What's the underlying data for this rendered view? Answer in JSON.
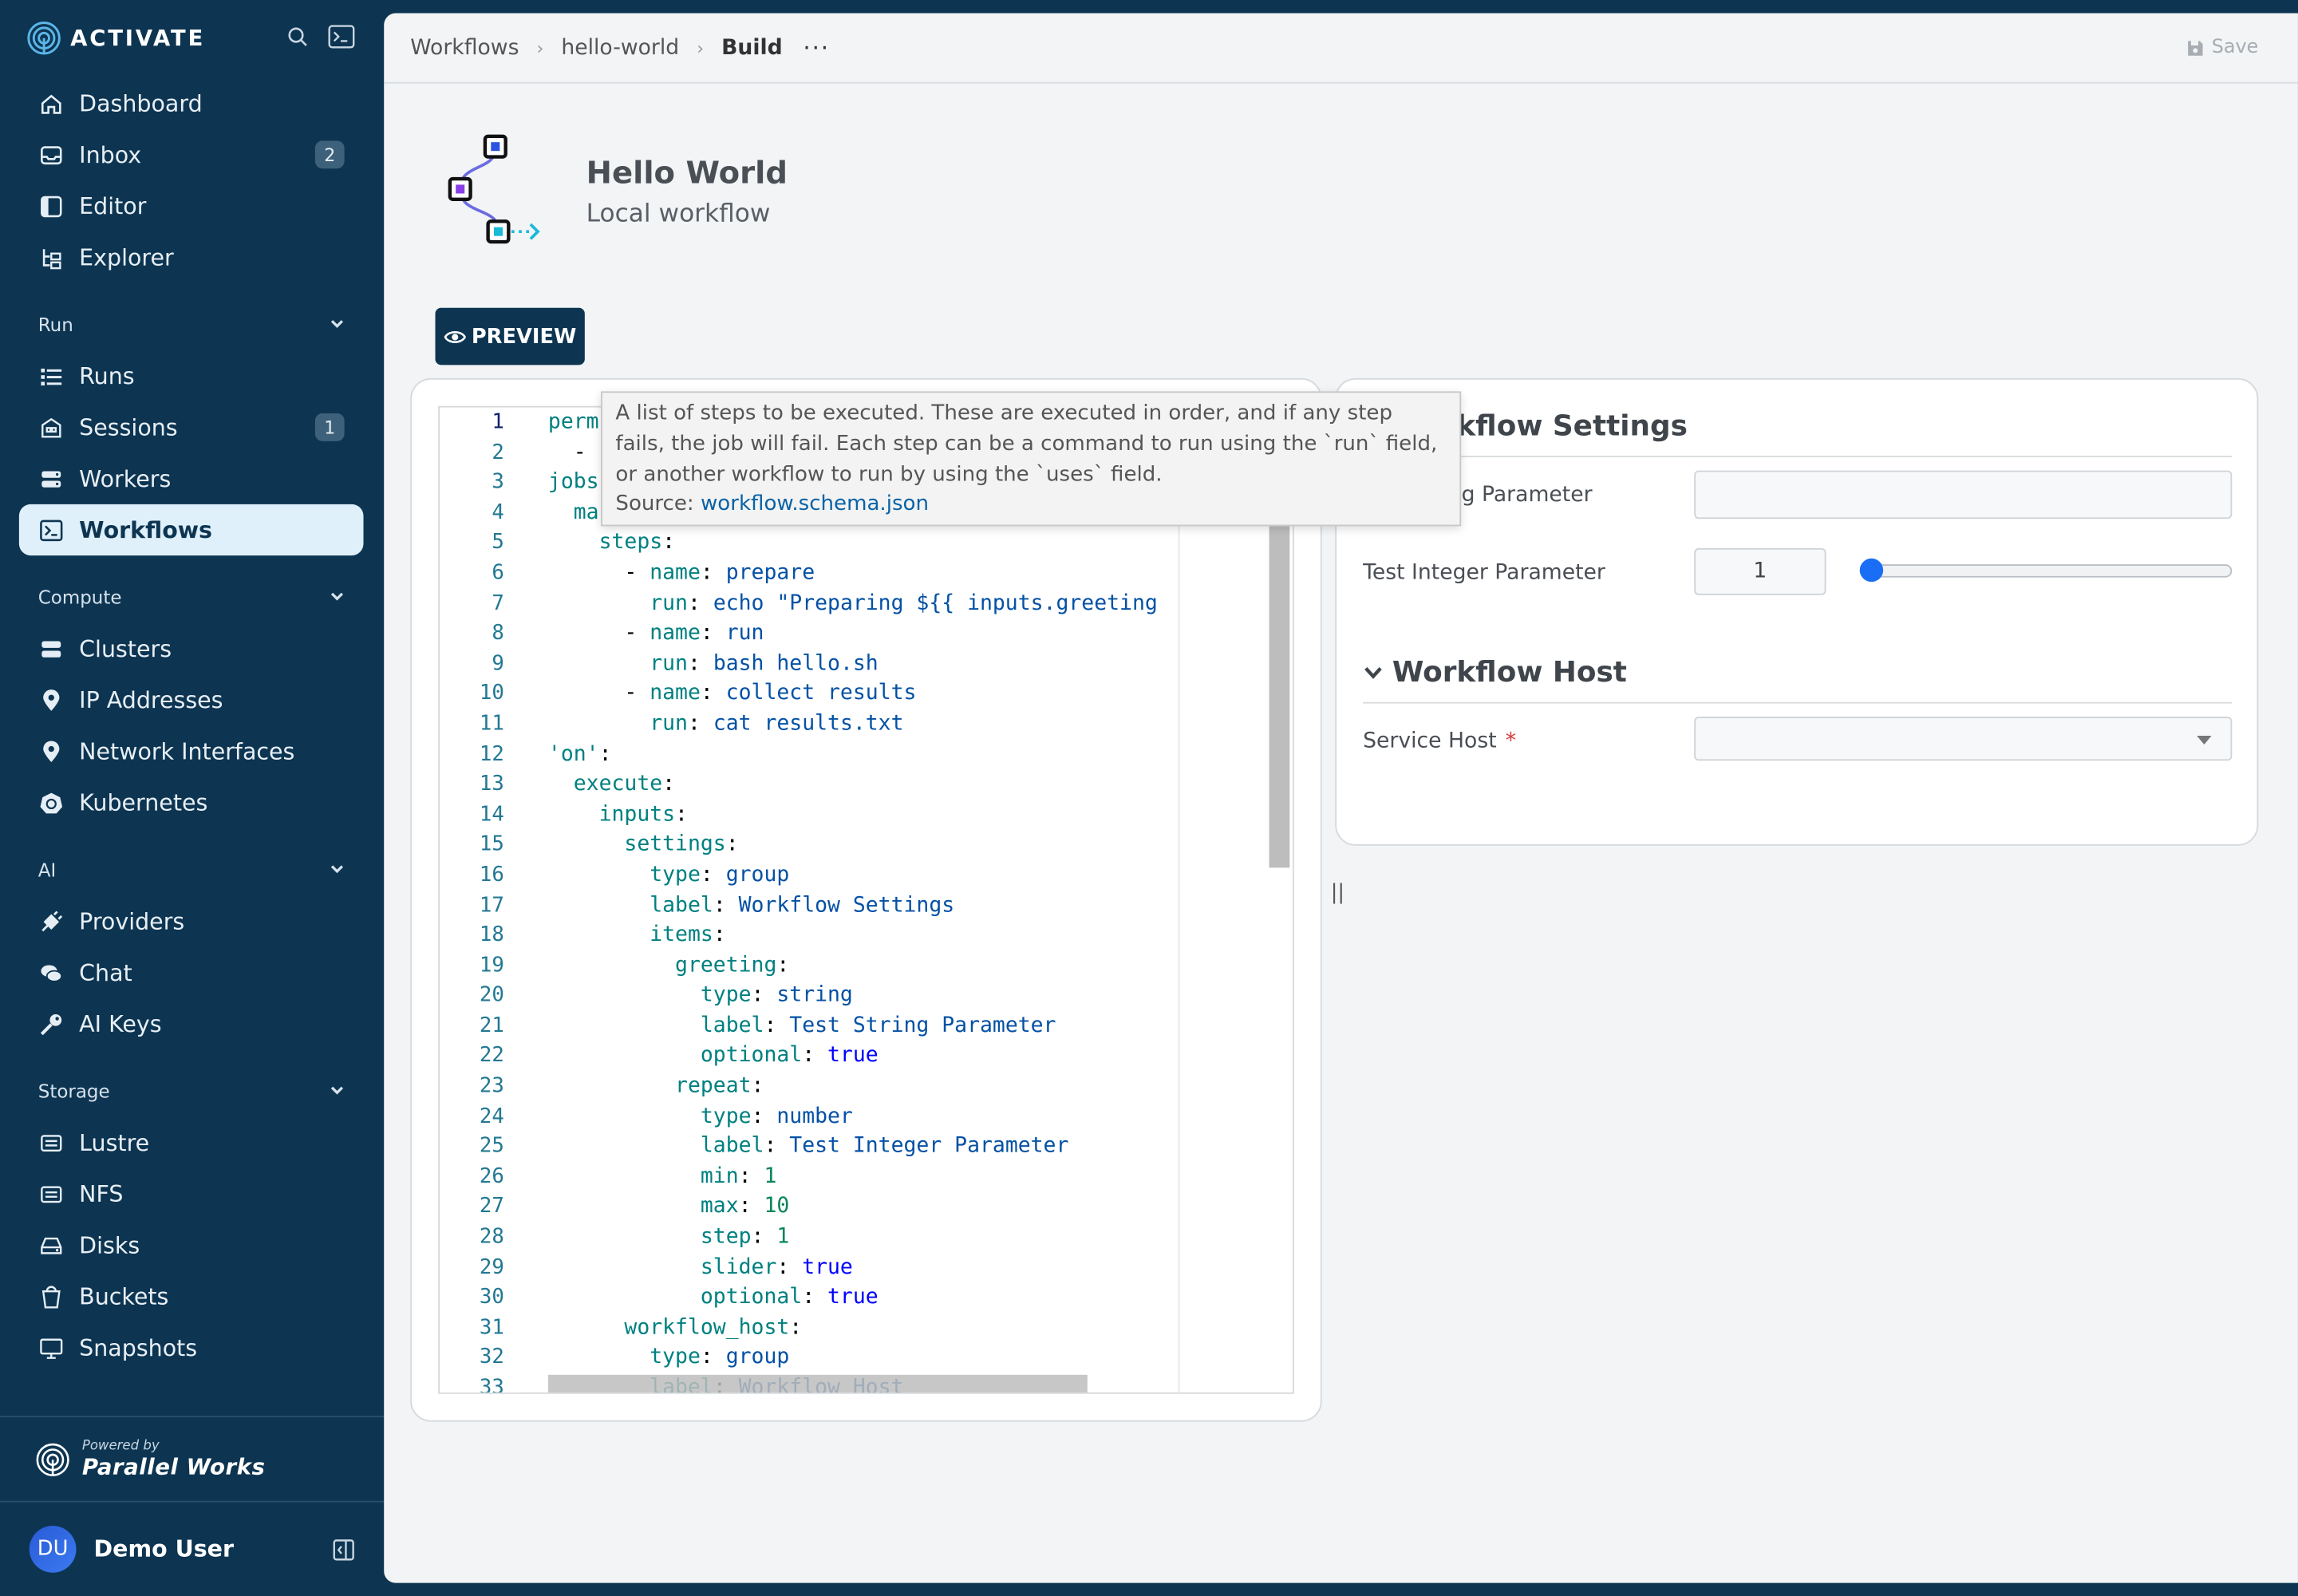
{
  "brand": {
    "name": "ACTIVATE"
  },
  "sidebar": {
    "main_items": [
      {
        "label": "Dashboard",
        "icon": "home-icon"
      },
      {
        "label": "Inbox",
        "icon": "inbox-icon",
        "badge": "2"
      },
      {
        "label": "Editor",
        "icon": "editor-icon"
      },
      {
        "label": "Explorer",
        "icon": "explorer-icon"
      }
    ],
    "run": {
      "title": "Run",
      "items": [
        {
          "label": "Runs",
          "icon": "list-icon"
        },
        {
          "label": "Sessions",
          "icon": "sessions-icon",
          "badge": "1"
        },
        {
          "label": "Workers",
          "icon": "server-icon"
        },
        {
          "label": "Workflows",
          "icon": "terminal-icon",
          "active": true
        }
      ]
    },
    "compute": {
      "title": "Compute",
      "items": [
        {
          "label": "Clusters",
          "icon": "server-icon"
        },
        {
          "label": "IP Addresses",
          "icon": "pin-icon"
        },
        {
          "label": "Network Interfaces",
          "icon": "pin-icon"
        },
        {
          "label": "Kubernetes",
          "icon": "kubernetes-icon"
        }
      ]
    },
    "ai": {
      "title": "AI",
      "items": [
        {
          "label": "Providers",
          "icon": "plug-icon"
        },
        {
          "label": "Chat",
          "icon": "chat-icon"
        },
        {
          "label": "AI Keys",
          "icon": "key-icon"
        }
      ]
    },
    "storage": {
      "title": "Storage",
      "items": [
        {
          "label": "Lustre",
          "icon": "lustre-icon"
        },
        {
          "label": "NFS",
          "icon": "nfs-icon"
        },
        {
          "label": "Disks",
          "icon": "disk-icon"
        },
        {
          "label": "Buckets",
          "icon": "bucket-icon"
        },
        {
          "label": "Snapshots",
          "icon": "monitor-icon"
        }
      ]
    },
    "powered_small": "Powered by",
    "powered_big": "Parallel Works",
    "user": {
      "initials": "DU",
      "name": "Demo User"
    }
  },
  "topbar": {
    "crumbs": [
      "Workflows",
      "hello-world",
      "Build"
    ],
    "more": "···",
    "save_label": "Save"
  },
  "workflow": {
    "title": "Hello World",
    "subtitle": "Local workflow",
    "preview_label": "PREVIEW"
  },
  "tooltip": {
    "text": "A list of steps to be executed. These are executed in order, and if any step fails, the job will fail. Each step can be a command to run using the `run` field, or another workflow to run by using the `uses` field.",
    "source_label": "Source: ",
    "source_link": "workflow.schema.json"
  },
  "editor": {
    "line_numbers": [
      "1",
      "2",
      "3",
      "4",
      "5",
      "6",
      "7",
      "8",
      "9",
      "10",
      "11",
      "12",
      "13",
      "14",
      "15",
      "16",
      "17",
      "18",
      "19",
      "20",
      "21",
      "22",
      "23",
      "24",
      "25",
      "26",
      "27",
      "28",
      "29",
      "30",
      "31",
      "32",
      "33"
    ]
  },
  "settings": {
    "section1_title": "Workflow Settings",
    "string_label": "Test String Parameter",
    "string_value": "",
    "integer_label": "Test Integer Parameter",
    "integer_value": "1",
    "slider": {
      "min": 1,
      "max": 10,
      "value": 1
    },
    "section2_title": "Workflow Host",
    "host_label": "Service Host",
    "host_required": "*",
    "host_value": ""
  },
  "splitter_glyph": "||",
  "colors": {
    "sidebar_bg": "#0d3552",
    "active_nav_bg": "#dff0fb",
    "accent": "#1a6ef5"
  }
}
